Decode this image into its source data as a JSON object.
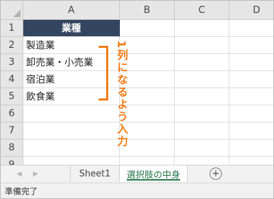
{
  "grid": {
    "columns": [
      "A",
      "B",
      "C",
      "D"
    ],
    "rows": [
      "1",
      "2",
      "3",
      "4",
      "5",
      "6",
      "7",
      "8",
      "9"
    ],
    "header_cell": "業種",
    "cells": [
      "製造業",
      "卸売業・小売業",
      "宿泊業",
      "飲食業"
    ]
  },
  "annotation": {
    "text": "1列になるよう入力",
    "color": "#f47a14"
  },
  "tabs": {
    "items": [
      "Sheet1",
      "選択肢の中身"
    ],
    "active": "選択肢の中身",
    "add_icon": "plus-circle-icon"
  },
  "status": {
    "text": "準備完了"
  },
  "colors": {
    "header_fill": "#34465f",
    "active_tab": "#217346"
  }
}
